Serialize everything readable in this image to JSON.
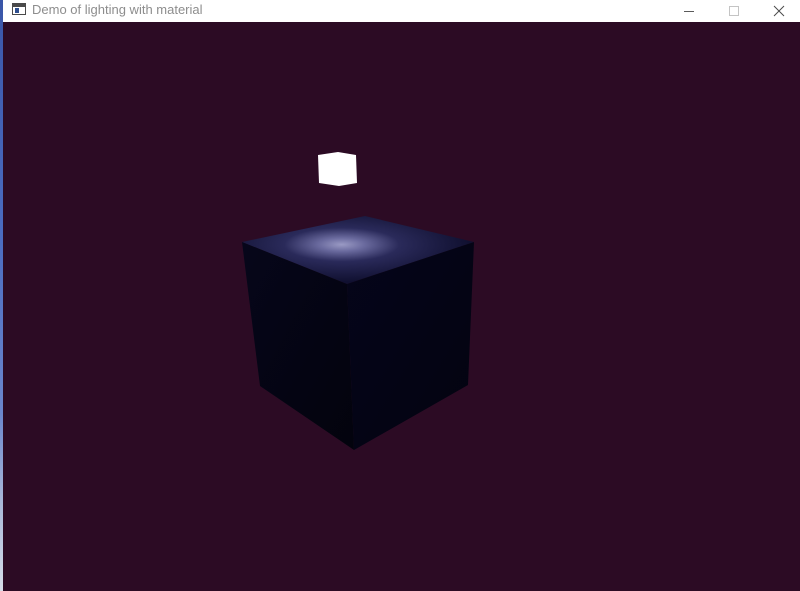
{
  "window": {
    "title": "Demo of lighting with material",
    "app_icon": "window-app-icon",
    "controls": {
      "minimize_icon": "minimize-icon",
      "maximize_icon": "maximize-icon",
      "close_icon": "close-icon"
    }
  },
  "scene": {
    "background_color": "#2c0b24",
    "light_cube_color": "#ffffff",
    "cube_face_color": "#04040f",
    "cube_top_color": "#14143a",
    "specular_highlight_color": "#9a9ac4"
  }
}
